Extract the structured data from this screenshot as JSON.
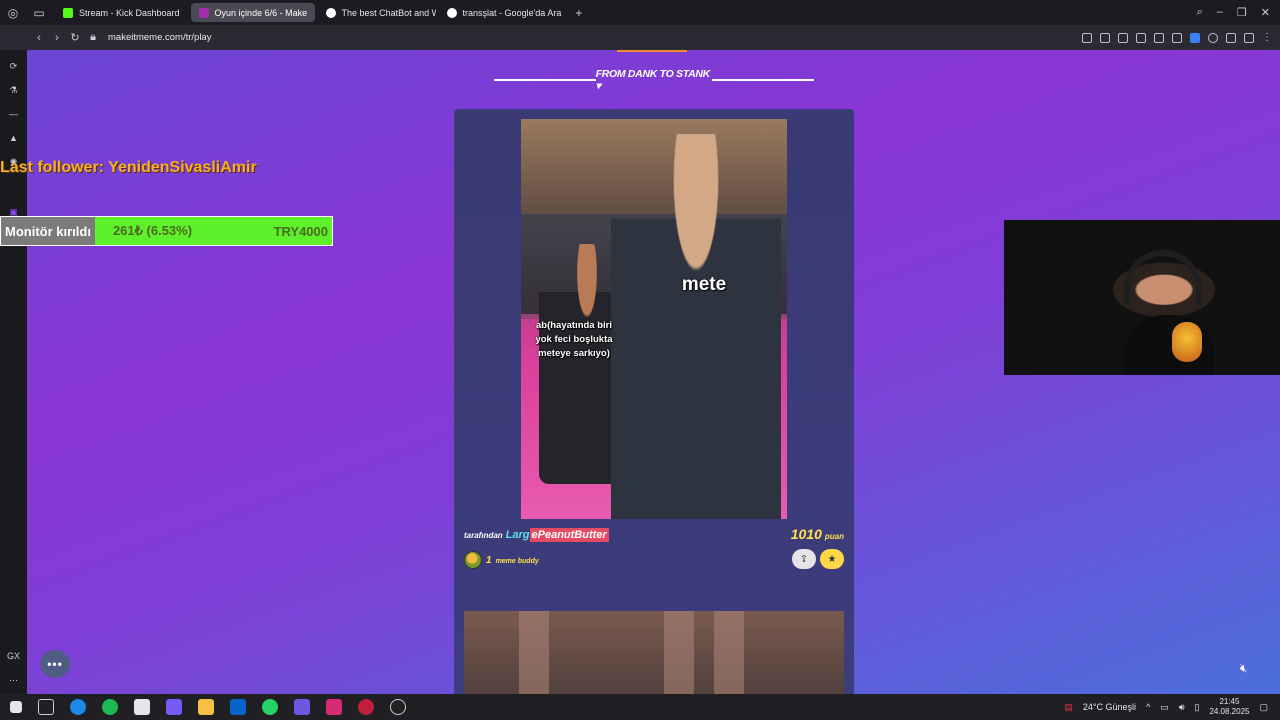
{
  "browser": {
    "tabs": [
      {
        "label": "Stream - Kick Dashboard",
        "favicon_color": "#53fc18",
        "active": false
      },
      {
        "label": "Oyun içinde 6/6 - Make",
        "favicon_color": "#a22ea8",
        "active": true
      },
      {
        "label": "The best ChatBot and W",
        "favicon_color": "#ffffff",
        "active": false
      },
      {
        "label": "transşlat - Google'da Ara",
        "favicon_color": "#ffffff",
        "active": false
      }
    ],
    "new_tab": "+",
    "url": "makeitmeme.com/tr/play"
  },
  "sidebar": {
    "items": [
      "refresh-icon",
      "flask-icon",
      "dash-icon",
      "aria-icon",
      "chatgpt-icon",
      "twitch-icon",
      "record-icon"
    ],
    "bottom_label": "GX"
  },
  "page": {
    "section_title": "FROM DANK TO STANK ▾",
    "meme": {
      "label_mete": "mete",
      "label_ab": "ab(hayatında biri\nyok feci boşlukta\nmeteye sarkıyo)"
    },
    "author": {
      "by": "tarafından",
      "name_a": "Larg",
      "name_b": "ePeanutButter"
    },
    "points": {
      "value": "1010",
      "label": "puan"
    },
    "buddy": {
      "count": "1",
      "label": "meme buddy"
    }
  },
  "overlay": {
    "last_follower": "Last follower: YenidenSivasliAmir",
    "goal": {
      "label": "Monitör kırıldı",
      "amount": "261₺ (6.53%)",
      "target": "TRY4000",
      "progress": 0.0653
    }
  },
  "taskbar": {
    "weather": "24°C  Güneşli",
    "time": "21:45",
    "date": "24.08.2025"
  }
}
